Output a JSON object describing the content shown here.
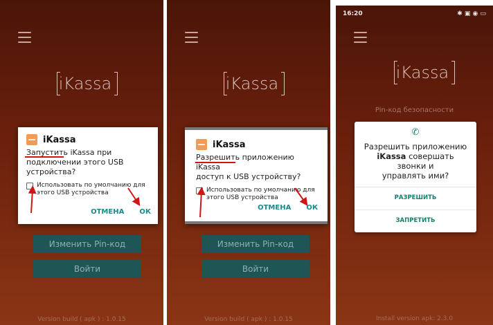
{
  "colors": {
    "background": "#6a1f0c",
    "button": "#1e5656",
    "accent": "#1b8a8a",
    "marker": "#d01515",
    "permission_accent": "#16806f"
  },
  "screens": [
    {
      "logo": "Kassa",
      "dialog": {
        "app_name": "iKassa",
        "message_lines": [
          "Запустить iKassa при",
          "подключении этого USB",
          "устройства?"
        ],
        "checkbox_label": "Использовать по умолчанию для этого USB устройства",
        "cancel_label": "ОТМЕНА",
        "ok_label": "ОК"
      },
      "change_pin_label": "Изменить Pin-код",
      "login_label": "Войти",
      "version": "Version build ( apk ) : 1.0.15"
    },
    {
      "logo": "Kassa",
      "dialog": {
        "app_name": "iKassa",
        "message_lines": [
          "Разрешить приложению iKassa",
          "доступ к USB устройству?"
        ],
        "checkbox_label": "Использовать по умолчанию для этого USB устройства",
        "cancel_label": "ОТМЕНА",
        "ok_label": "ОК"
      },
      "change_pin_label": "Изменить Pin-код",
      "login_label": "Войти",
      "version": "Version build ( apk ) : 1.0.15"
    },
    {
      "status_time": "16:20",
      "status_icons": "✱ ▣ ◉ ▭",
      "logo": "Kassa",
      "security_label": "Pin-код безопасности",
      "permission": {
        "q1": "Разрешить приложению",
        "app": "iKassa",
        "q2": "совершать звонки и",
        "q3": "управлять ими?",
        "allow_label": "РАЗРЕШИТЬ",
        "deny_label": "ЗАПРЕТИТЬ"
      },
      "version": "Install version apk: 2.3.0"
    }
  ]
}
